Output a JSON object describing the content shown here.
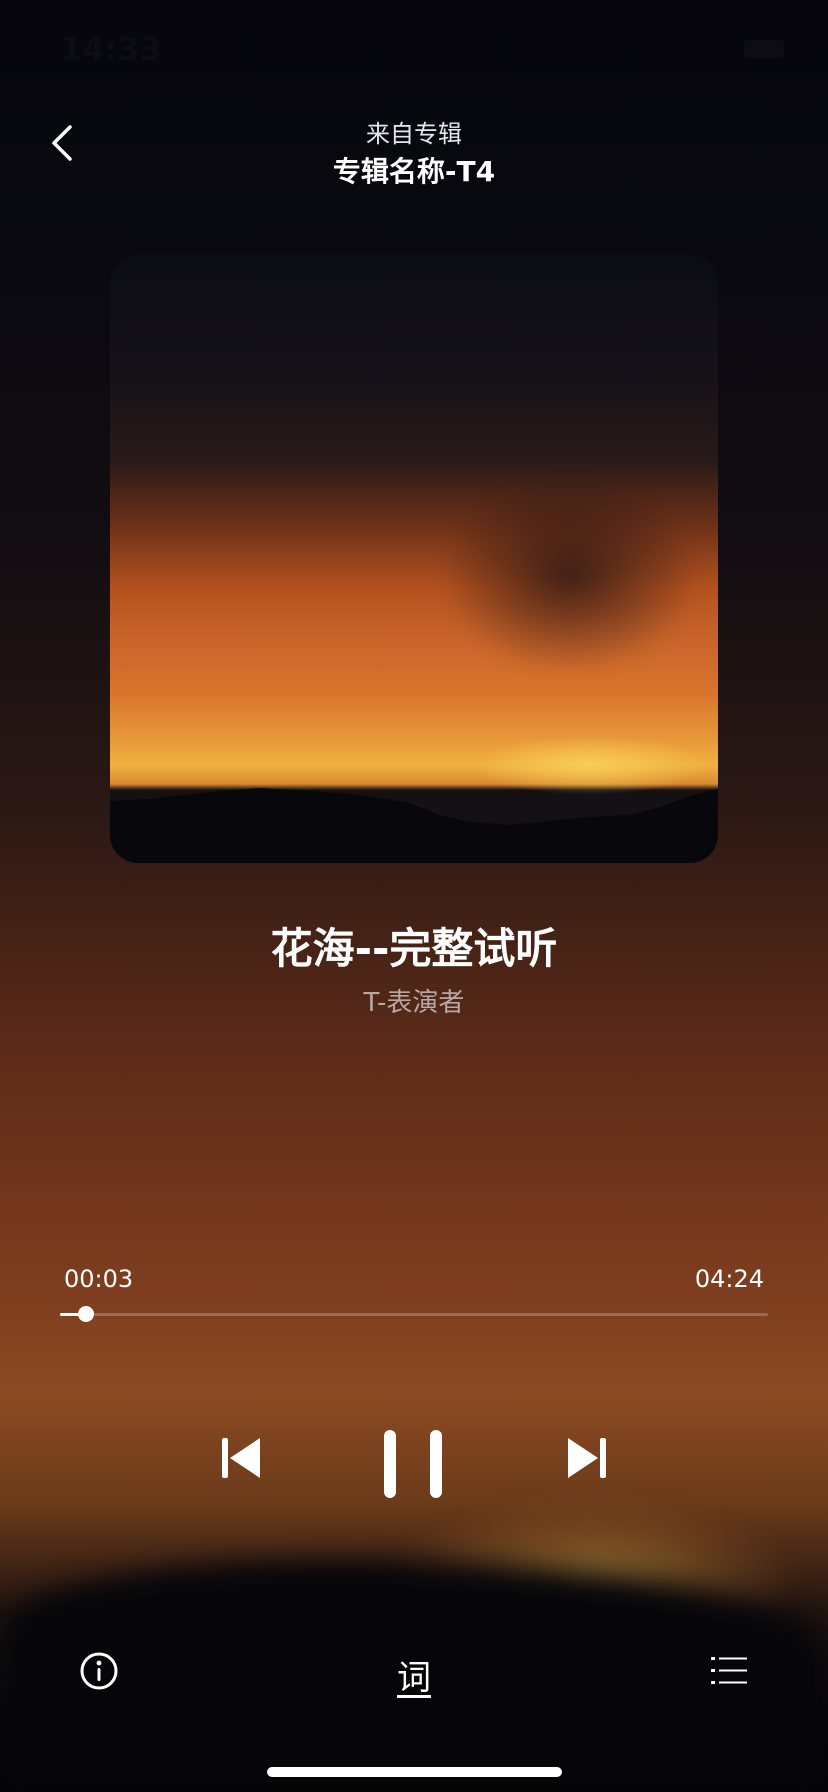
{
  "status_bar": {
    "time": "14:33"
  },
  "header": {
    "subtitle": "来自专辑",
    "album_name": "专辑名称-T4"
  },
  "track": {
    "title": "花海--完整试听",
    "artist": "T-表演者"
  },
  "playback": {
    "elapsed": "00:03",
    "duration": "04:24",
    "progress_fraction": 0.012
  },
  "bottom_bar": {
    "lyrics_label": "词"
  },
  "icons": {
    "back": "chevron-left-icon",
    "prev": "skip-previous-icon",
    "pause": "pause-icon",
    "next": "skip-next-icon",
    "info": "info-icon",
    "playlist": "list-icon"
  },
  "colors": {
    "accent": "#ffffff",
    "artist_text": "#b8a8a4"
  }
}
